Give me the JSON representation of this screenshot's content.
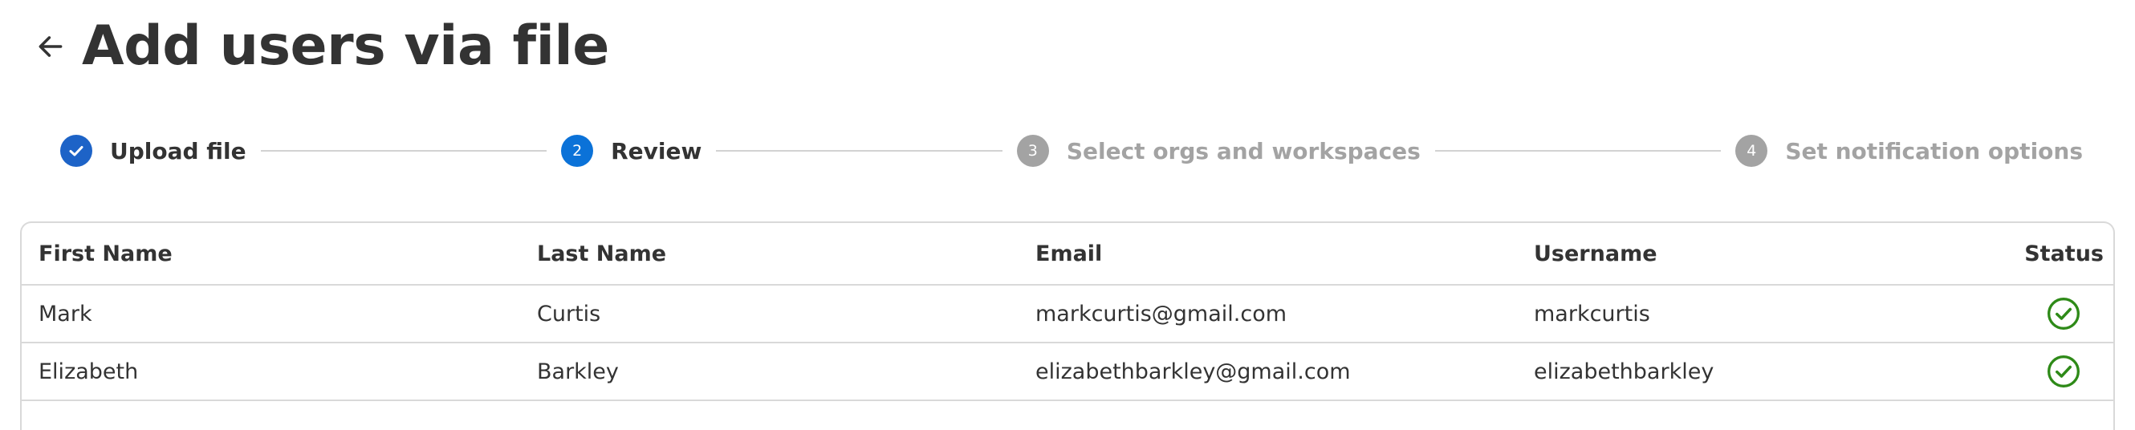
{
  "page": {
    "title": "Add users via file",
    "back_icon": "arrow-left-icon"
  },
  "stepper": {
    "steps": [
      {
        "number": "1",
        "label": "Upload file",
        "state": "complete",
        "icon": "check-icon"
      },
      {
        "number": "2",
        "label": "Review",
        "state": "active"
      },
      {
        "number": "3",
        "label": "Select orgs and workspaces",
        "state": "upcoming"
      },
      {
        "number": "4",
        "label": "Set notification options",
        "state": "upcoming"
      }
    ]
  },
  "table": {
    "columns": [
      "First Name",
      "Last Name",
      "Email",
      "Username",
      "Status"
    ],
    "rows": [
      {
        "first_name": "Mark",
        "last_name": "Curtis",
        "email": "markcurtis@gmail.com",
        "username": "markcurtis",
        "status_icon": "check-circle-icon"
      },
      {
        "first_name": "Elizabeth",
        "last_name": "Barkley",
        "email": "elizabethbarkley@gmail.com",
        "username": "elizabethbarkley",
        "status_icon": "check-circle-icon"
      }
    ]
  },
  "colors": {
    "primary": "#0b72d8",
    "complete": "#1d63c7",
    "inactive": "#a3a3a3",
    "success": "#2e8a18",
    "text": "#333333",
    "border": "#d9d9d9"
  }
}
